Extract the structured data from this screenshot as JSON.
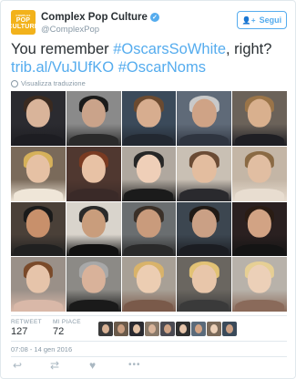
{
  "tweet": {
    "account_name": "Complex Pop Culture",
    "handle": "@ComplexPop",
    "avatar_line1": "COMPLEX",
    "avatar_line2": "POP",
    "avatar_line3": "CULTURE",
    "follow_label": "Segui",
    "text_prefix": "You remember ",
    "hashtag1": "#OscarsSoWhite",
    "text_mid": ", right?",
    "link": "trib.al/VuJUfKO",
    "hashtag2": "#OscarNoms",
    "translate_label": "Visualizza traduzione",
    "retweet_label": "RETWEET",
    "retweet_count": "127",
    "likes_label": "MI PIACE",
    "likes_count": "72",
    "timestamp": "07:08 - 14 gen 2016"
  },
  "icons": {
    "follow": "add-user-icon",
    "verified": "verified-badge-icon",
    "translate": "globe-icon",
    "reply": "reply-icon",
    "retweet": "retweet-icon",
    "like": "heart-icon",
    "more": "more-icon"
  },
  "colors": {
    "accent": "#55acee",
    "brand_avatar": "#f2b21b",
    "text": "#292f33",
    "muted": "#8899a6"
  }
}
